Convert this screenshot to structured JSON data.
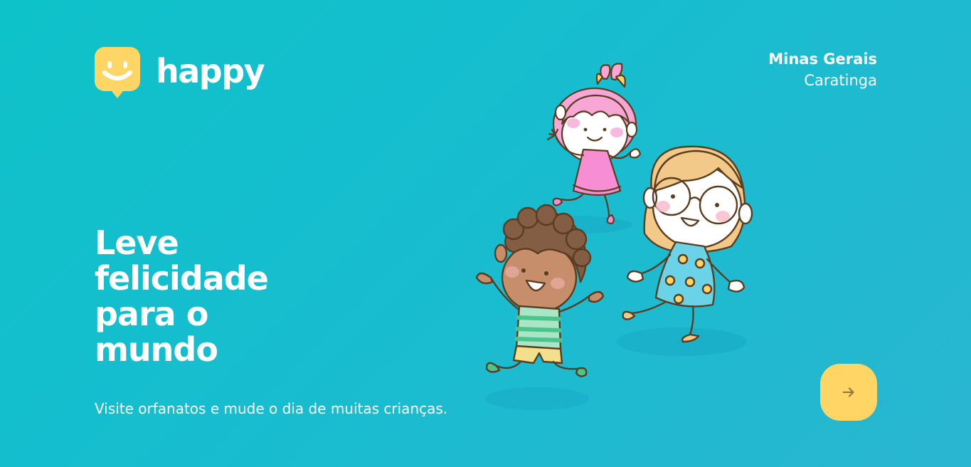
{
  "brand": {
    "name": "happy",
    "logo_icon": "smile-chat-bubble-icon",
    "logo_color": "#ffd666"
  },
  "location": {
    "state": "Minas Gerais",
    "city": "Caratinga"
  },
  "hero": {
    "headline_lines": [
      "Leve",
      "felicidade",
      "para o",
      "mundo"
    ],
    "tagline": "Visite orfanatos e mude o dia de muitas crianças."
  },
  "illustration": {
    "name": "happy-children-illustration"
  },
  "enter_button": {
    "icon": "arrow-right-icon",
    "color": "#ffd666"
  },
  "colors": {
    "background_start": "#0ec2c9",
    "background_end": "#29b6d1",
    "accent": "#ffd666",
    "text": "#ffffff"
  }
}
